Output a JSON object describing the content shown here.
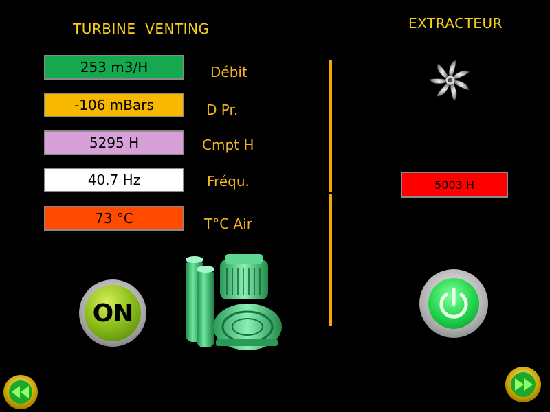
{
  "turbine": {
    "title": "TURBINE  VENTING",
    "values": [
      {
        "value": "253 m3/H",
        "label": "Débit",
        "color": "#15a84e"
      },
      {
        "value": "-106 mBars",
        "label": "D Pr.",
        "color": "#f8b800"
      },
      {
        "value": "5295 H",
        "label": "Cmpt H",
        "color": "#d8a0d8"
      },
      {
        "value": "40.7 Hz",
        "label": "Fréqu.",
        "color": "#ffffff"
      },
      {
        "value": "73 °C",
        "label": "T°C Air",
        "color": "#ff4a00"
      }
    ],
    "on_button": "ON",
    "pump_icon": "blower-motor-icon"
  },
  "extracteur": {
    "title": "EXTRACTEUR",
    "fan_icon": "fan-icon",
    "hours": "5003 H",
    "hours_color": "#ff0000",
    "power_icon": "power-icon"
  },
  "nav": {
    "back_icon": "rewind-icon",
    "forward_icon": "fast-forward-icon"
  },
  "colors": {
    "accent_text": "#f5d21a",
    "divider": "#f2a900"
  }
}
